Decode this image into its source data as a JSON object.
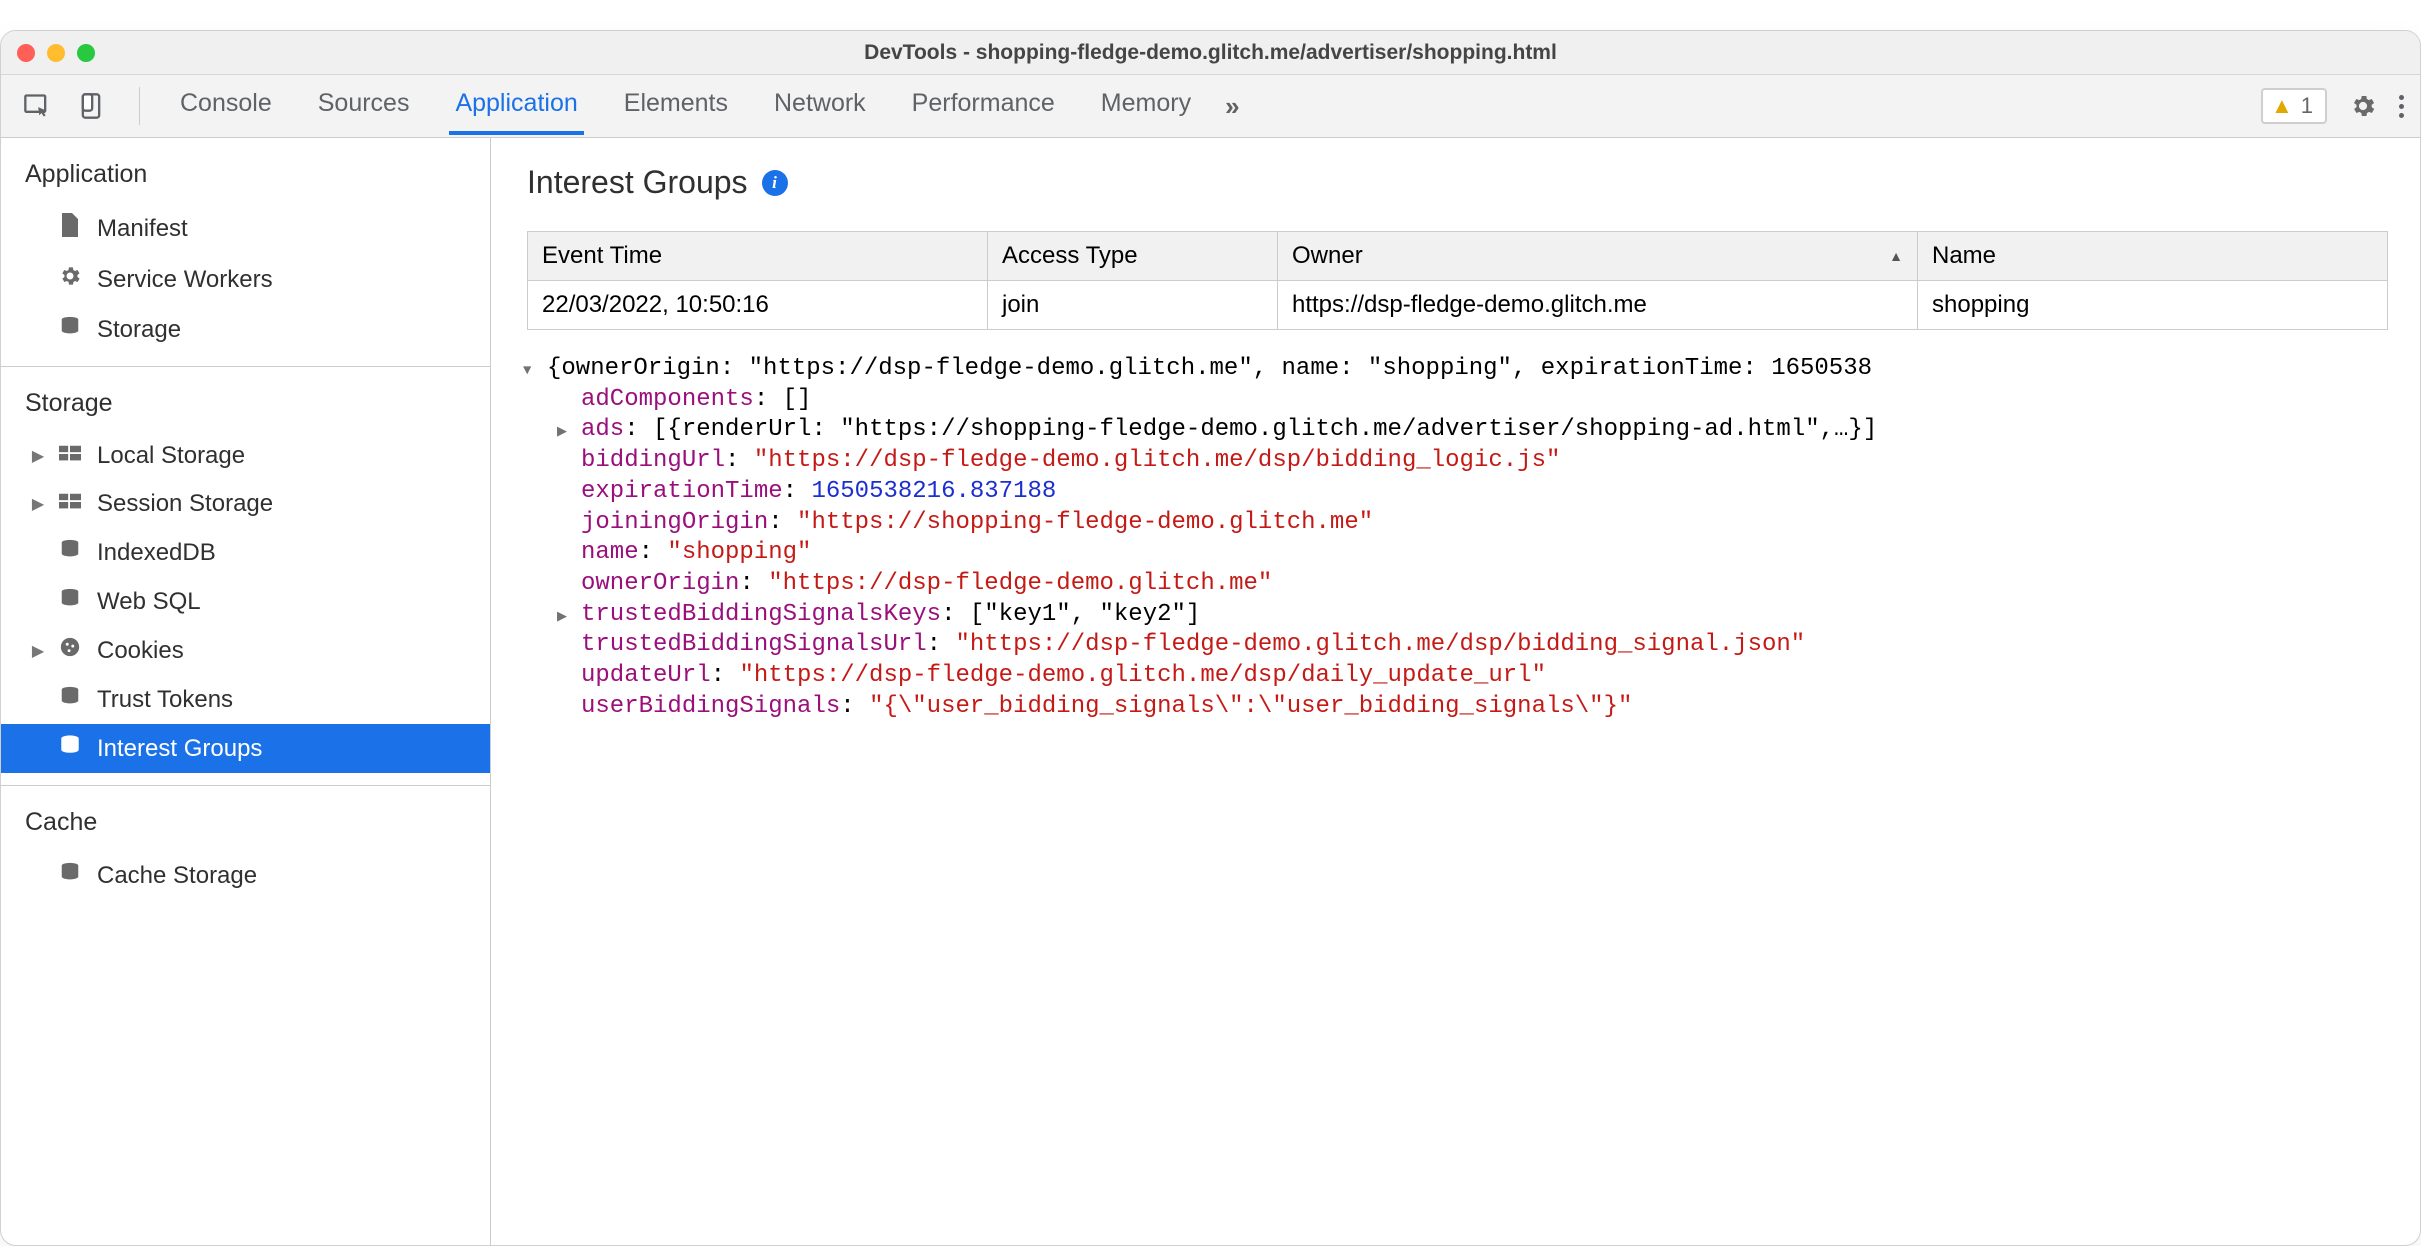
{
  "window": {
    "title": "DevTools - shopping-fledge-demo.glitch.me/advertiser/shopping.html"
  },
  "toolbar": {
    "tabs": [
      "Console",
      "Sources",
      "Application",
      "Elements",
      "Network",
      "Performance",
      "Memory"
    ],
    "active_tab": "Application",
    "warning_count": "1"
  },
  "sidebar": {
    "sections": [
      {
        "title": "Application",
        "items": [
          {
            "icon": "file-icon",
            "label": "Manifest"
          },
          {
            "icon": "gear-icon",
            "label": "Service Workers"
          },
          {
            "icon": "database-icon",
            "label": "Storage"
          }
        ]
      },
      {
        "title": "Storage",
        "items": [
          {
            "tw": "▶",
            "icon": "grid-icon",
            "label": "Local Storage"
          },
          {
            "tw": "▶",
            "icon": "grid-icon",
            "label": "Session Storage"
          },
          {
            "icon": "database-icon",
            "label": "IndexedDB"
          },
          {
            "icon": "database-icon",
            "label": "Web SQL"
          },
          {
            "tw": "▶",
            "icon": "cookie-icon",
            "label": "Cookies"
          },
          {
            "icon": "database-icon",
            "label": "Trust Tokens"
          },
          {
            "icon": "database-icon",
            "label": "Interest Groups",
            "selected": true
          }
        ]
      },
      {
        "title": "Cache",
        "items": [
          {
            "icon": "database-icon",
            "label": "Cache Storage"
          }
        ]
      }
    ]
  },
  "main": {
    "heading": "Interest Groups",
    "columns": [
      "Event Time",
      "Access Type",
      "Owner",
      "Name"
    ],
    "rows": [
      {
        "Event Time": "22/03/2022, 10:50:16",
        "Access Type": "join",
        "Owner": "https://dsp-fledge-demo.glitch.me",
        "Name": "shopping"
      }
    ],
    "json": {
      "summary": "{ownerOrigin: \"https://dsp-fledge-demo.glitch.me\", name: \"shopping\", expirationTime: 1650538",
      "adComponents_key": "adComponents",
      "adComponents_val": "[]",
      "ads_key": "ads",
      "ads_val": "[{renderUrl: \"https://shopping-fledge-demo.glitch.me/advertiser/shopping-ad.html\",…}]",
      "biddingUrl_key": "biddingUrl",
      "biddingUrl_val": "\"https://dsp-fledge-demo.glitch.me/dsp/bidding_logic.js\"",
      "expirationTime_key": "expirationTime",
      "expirationTime_val": "1650538216.837188",
      "joiningOrigin_key": "joiningOrigin",
      "joiningOrigin_val": "\"https://shopping-fledge-demo.glitch.me\"",
      "name_key": "name",
      "name_val": "\"shopping\"",
      "ownerOrigin_key": "ownerOrigin",
      "ownerOrigin_val": "\"https://dsp-fledge-demo.glitch.me\"",
      "tbsk_key": "trustedBiddingSignalsKeys",
      "tbsk_val": "[\"key1\", \"key2\"]",
      "tbsu_key": "trustedBiddingSignalsUrl",
      "tbsu_val": "\"https://dsp-fledge-demo.glitch.me/dsp/bidding_signal.json\"",
      "updateUrl_key": "updateUrl",
      "updateUrl_val": "\"https://dsp-fledge-demo.glitch.me/dsp/daily_update_url\"",
      "ubs_key": "userBiddingSignals",
      "ubs_val": "\"{\\\"user_bidding_signals\\\":\\\"user_bidding_signals\\\"}\""
    }
  }
}
